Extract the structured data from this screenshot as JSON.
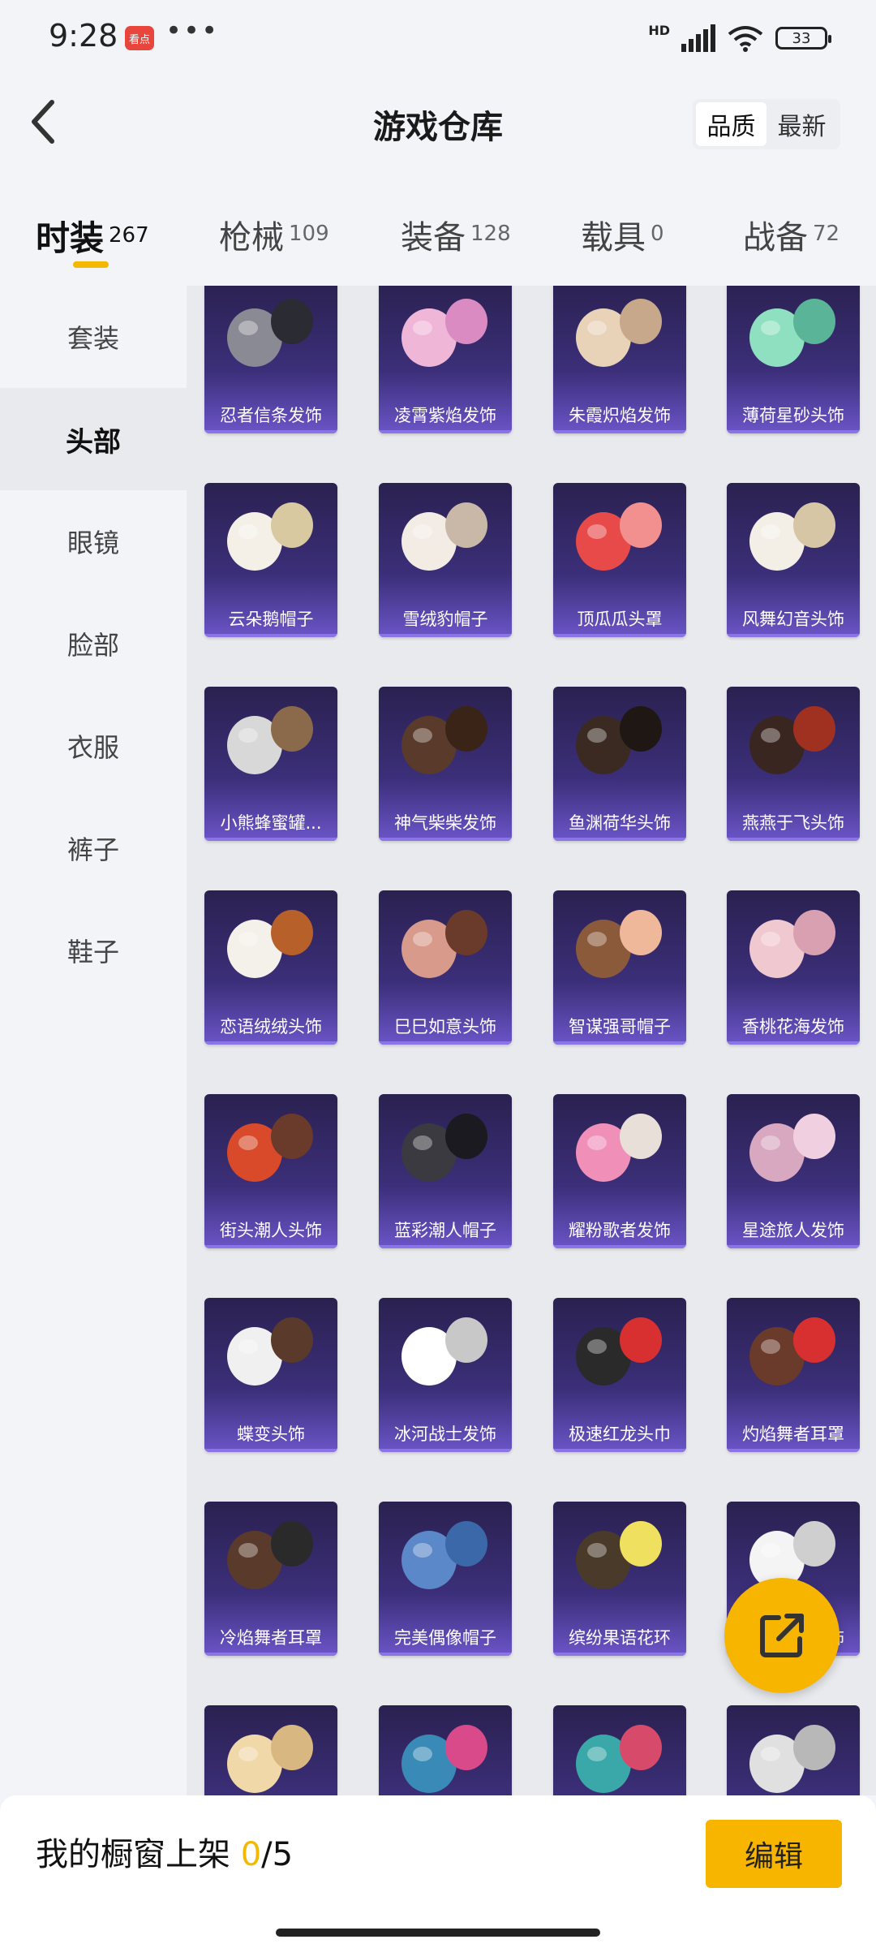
{
  "status_bar": {
    "time": "9:28",
    "app_badge": "看点",
    "network": "HD",
    "battery": "33"
  },
  "header": {
    "title": "游戏仓库",
    "sort_options": [
      "品质",
      "最新"
    ],
    "sort_selected": "品质"
  },
  "tabs": [
    {
      "label": "时装",
      "count": "267",
      "active": true
    },
    {
      "label": "枪械",
      "count": "109"
    },
    {
      "label": "装备",
      "count": "128"
    },
    {
      "label": "载具",
      "count": "0"
    },
    {
      "label": "战备",
      "count": "72"
    }
  ],
  "sidebar": {
    "items": [
      "套装",
      "头部",
      "眼镜",
      "脸部",
      "衣服",
      "裤子",
      "鞋子"
    ],
    "active": "头部"
  },
  "items": [
    "忍者信条发饰",
    "凌霄紫焰发饰",
    "朱霞炽焰发饰",
    "薄荷星砂头饰",
    "云朵鹅帽子",
    "雪绒豹帽子",
    "顶瓜瓜头罩",
    "风舞幻音头饰",
    "小熊蜂蜜罐...",
    "神气柴柴发饰",
    "鱼渊荷华头饰",
    "燕燕于飞头饰",
    "恋语绒绒头饰",
    "巳巳如意头饰",
    "智谋强哥帽子",
    "香桃花海发饰",
    "街头潮人头饰",
    "蓝彩潮人帽子",
    "耀粉歌者发饰",
    "星途旅人发饰",
    "蝶变头饰",
    "冰河战士发饰",
    "极速红龙头巾",
    "灼焰舞者耳罩",
    "冷焰舞者耳罩",
    "完美偶像帽子",
    "缤纷果语花环",
    "元素星魂发饰",
    "",
    "",
    "",
    ""
  ],
  "bottom": {
    "showcase_label": "我的橱窗上架",
    "showcase_current": "0",
    "showcase_total": "/5",
    "edit_label": "编辑"
  },
  "colors": {
    "accent": "#f7b500",
    "card_top": "#2a2150",
    "card_bottom": "#6b55c8"
  },
  "icons": {
    "fab": "share-external-icon",
    "back": "chevron-left-icon"
  }
}
